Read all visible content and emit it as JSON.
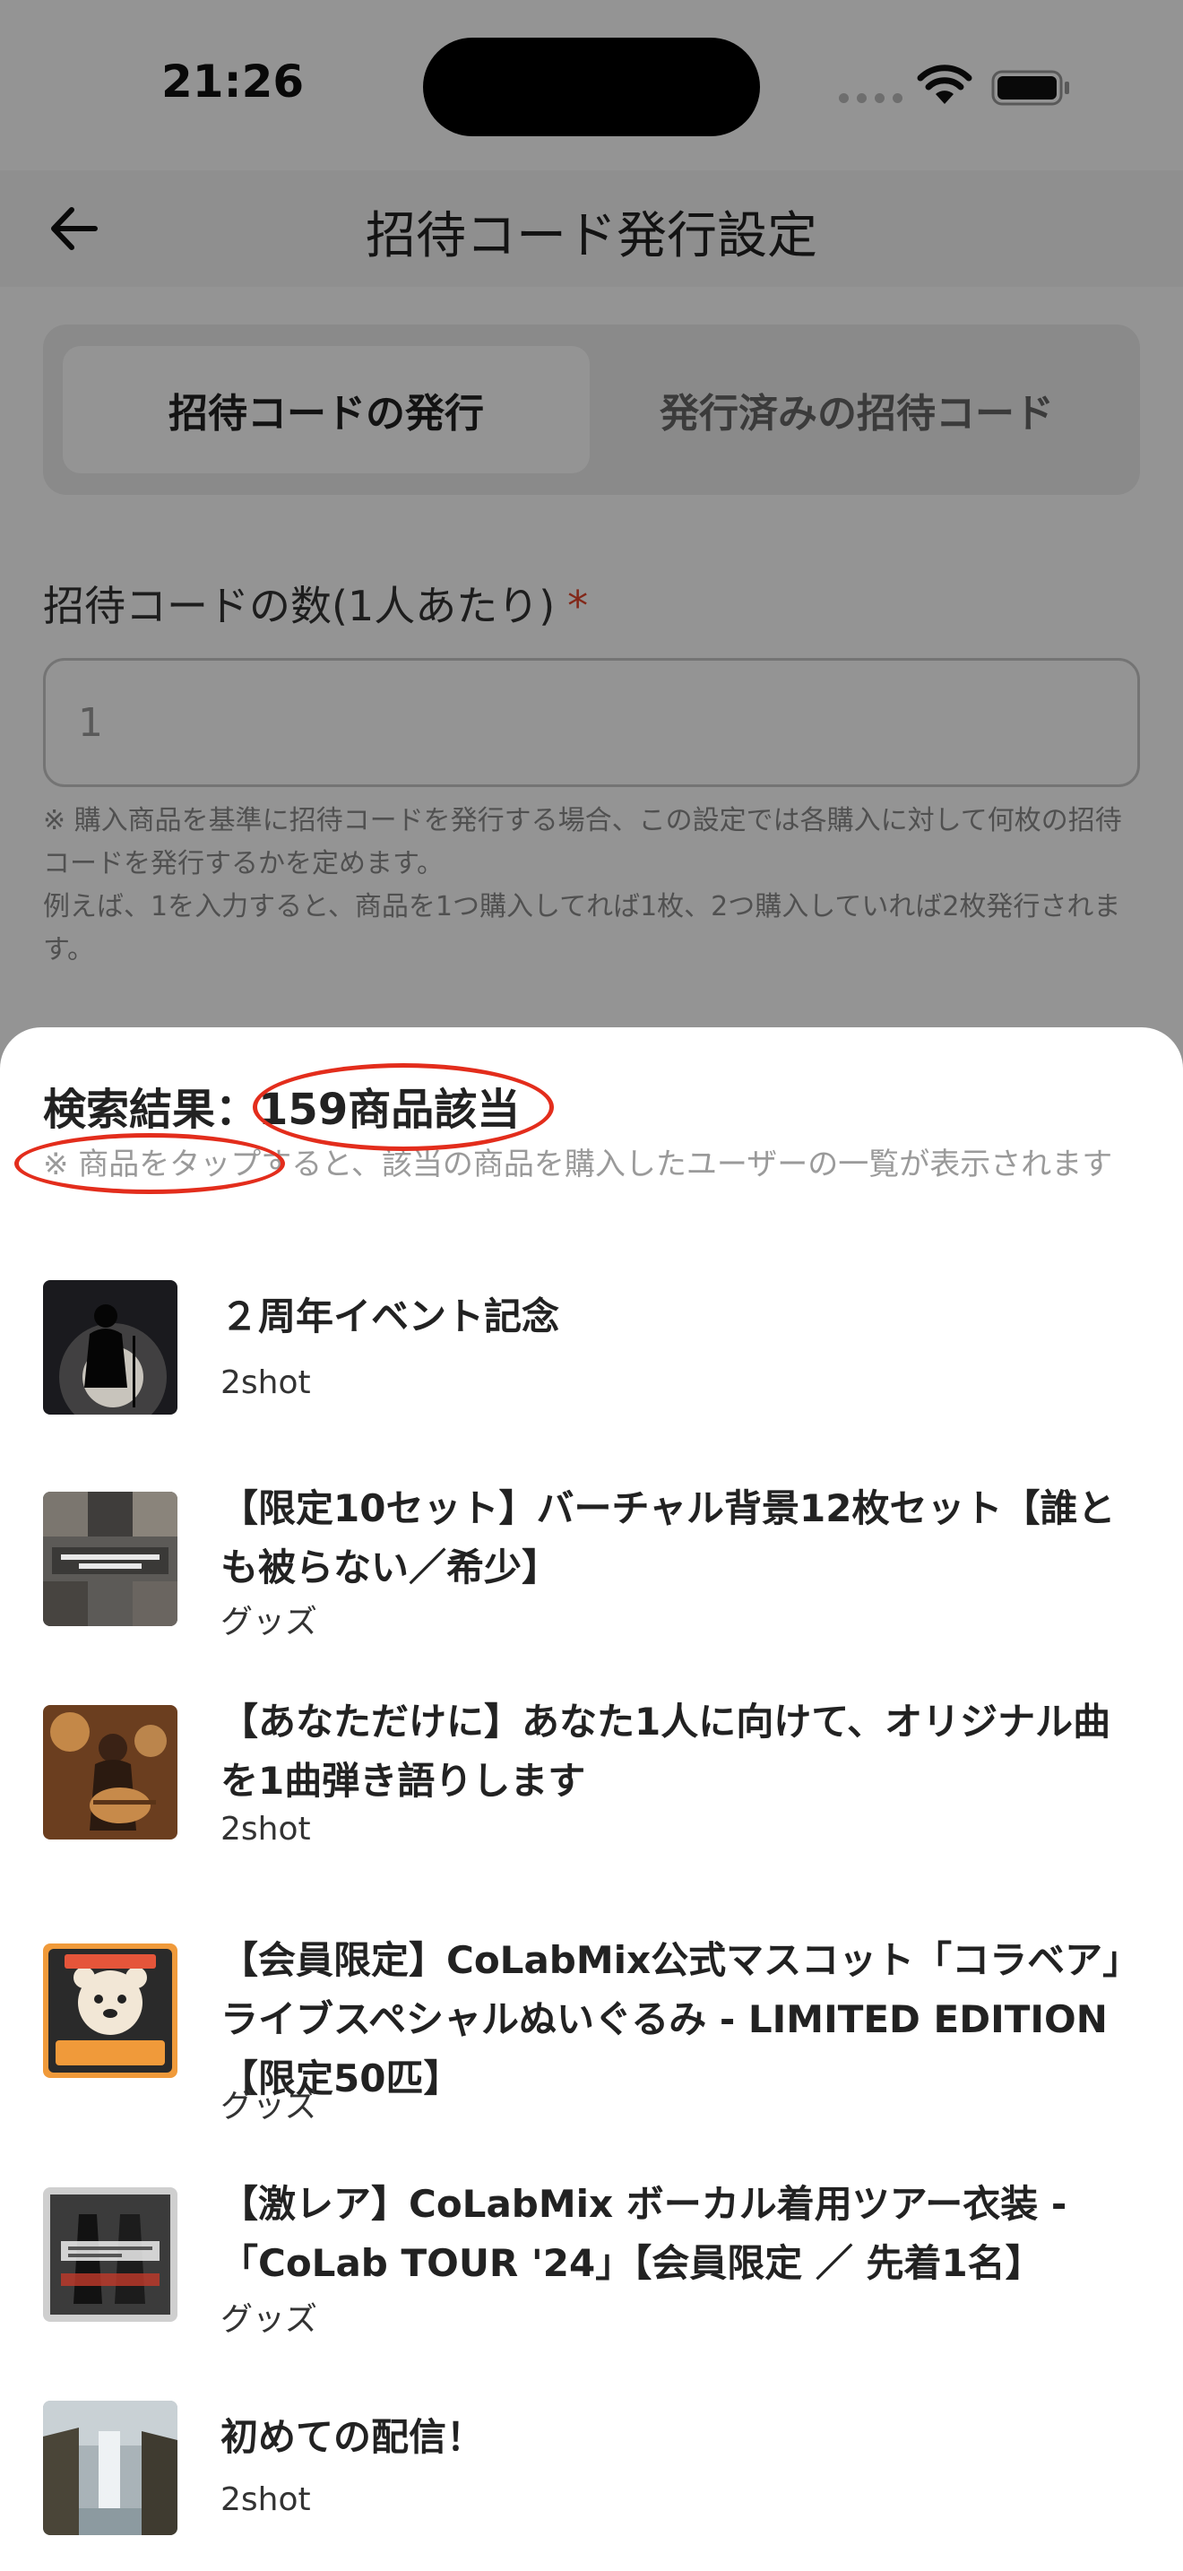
{
  "status": {
    "time": "21:26"
  },
  "nav": {
    "title": "招待コード発行設定"
  },
  "tabs": [
    {
      "label": "招待コードの発行",
      "active": true
    },
    {
      "label": "発行済みの招待コード",
      "active": false
    }
  ],
  "form": {
    "label": "招待コードの数(1人あたり)",
    "required_mark": "*",
    "value": "1",
    "hint_line1": "※ 購入商品を基準に招待コードを発行する場合、この設定では各購入に対して何枚の招待コードを発行するかを定めます。",
    "hint_line2": "例えば、1を入力すると、商品を1つ購入してれば1枚、2つ購入していれば2枚発行されます。"
  },
  "sheet": {
    "result_prefix": "検索結果：",
    "result_count": "159商品該当",
    "note": "※ 商品をタップすると、該当の商品を購入したユーザーの一覧が表示されます",
    "items": [
      {
        "title": "２周年イベント記念",
        "category": "2shot",
        "thumb": "concert-silhouette"
      },
      {
        "title": "【限定10セット】バーチャル背景12枚セット【誰とも被らない／希少】",
        "category": "グッズ",
        "thumb": "virtual-background"
      },
      {
        "title": "【あなただけに】あなた1人に向けて、オリジナル曲を1曲弾き語りします",
        "category": "2shot",
        "thumb": "guitar-singer"
      },
      {
        "title": "【会員限定】CoLabMix公式マスコット「コラベア」ライブスペシャルぬいぐるみ - LIMITED EDITION【限定50匹】",
        "category": "グッズ",
        "thumb": "mascot-bear"
      },
      {
        "title": "【激レア】CoLabMix ボーカル着用ツアー衣装 - 「CoLab TOUR '24」【会員限定 ／ 先着1名】",
        "category": "グッズ",
        "thumb": "tour-costume"
      },
      {
        "title": "初めての配信！",
        "category": "2shot",
        "thumb": "waterfall"
      }
    ]
  },
  "colors": {
    "annotation": "#e32d1c",
    "required": "#e0462c"
  }
}
